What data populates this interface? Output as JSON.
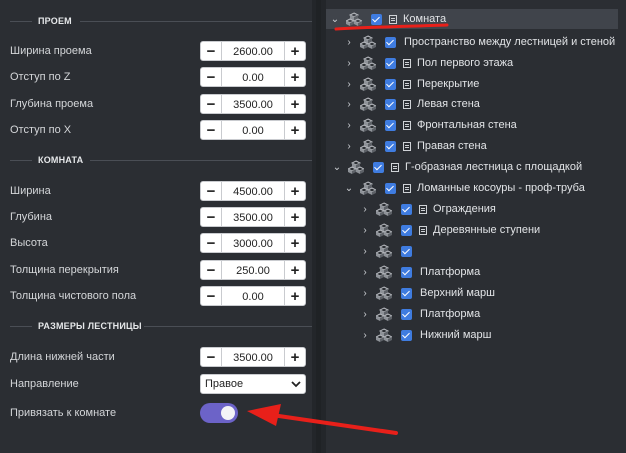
{
  "sections": {
    "opening": "ПРОЕМ",
    "room": "КОМНАТА",
    "stairs": "РАЗМЕРЫ ЛЕСТНИЦЫ"
  },
  "opening_fields": [
    {
      "label": "Ширина проема",
      "value": "2600.00"
    },
    {
      "label": "Отступ по Z",
      "value": "0.00"
    },
    {
      "label": "Глубина проема",
      "value": "3500.00"
    },
    {
      "label": "Отступ по X",
      "value": "0.00"
    }
  ],
  "room_fields": [
    {
      "label": "Ширина",
      "value": "4500.00"
    },
    {
      "label": "Глубина",
      "value": "3500.00"
    },
    {
      "label": "Высота",
      "value": "3000.00"
    },
    {
      "label": "Толщина перекрытия",
      "value": "250.00"
    },
    {
      "label": "Толщина чистового пола",
      "value": "0.00"
    }
  ],
  "stairs_fields": {
    "lower_length": {
      "label": "Длина нижней части",
      "value": "3500.00"
    },
    "direction": {
      "label": "Направление",
      "value": "Правое"
    },
    "bind_to_room": {
      "label": "Привязать к комнате",
      "enabled": true
    }
  },
  "stepper": {
    "minus": "−",
    "plus": "+"
  },
  "tree": [
    {
      "name": "Комната",
      "checked": true,
      "has_doc": true,
      "expanded": true
    },
    {
      "name": "Пространство между лестницей и стеной",
      "checked": true,
      "has_doc": false,
      "expanded": false
    },
    {
      "name": "Пол первого этажа",
      "checked": true,
      "has_doc": true,
      "expanded": false
    },
    {
      "name": "Перекрытие",
      "checked": true,
      "has_doc": true,
      "expanded": false
    },
    {
      "name": "Левая стена",
      "checked": true,
      "has_doc": true,
      "expanded": false
    },
    {
      "name": "Фронтальная стена",
      "checked": true,
      "has_doc": true,
      "expanded": false
    },
    {
      "name": "Правая стена",
      "checked": true,
      "has_doc": true,
      "expanded": false
    },
    {
      "name": "Г-образная лестница с площадкой",
      "checked": true,
      "has_doc": true,
      "expanded": true
    },
    {
      "name": "Ломанные косоуры - проф-труба",
      "checked": true,
      "has_doc": true,
      "expanded": true
    },
    {
      "name": "Ограждения",
      "checked": true,
      "has_doc": true,
      "expanded": false
    },
    {
      "name": "Деревянные ступени",
      "checked": true,
      "has_doc": true,
      "expanded": false
    },
    {
      "name": "",
      "checked": true,
      "has_doc": false,
      "expanded": false
    },
    {
      "name": "Платформа",
      "checked": true,
      "has_doc": false,
      "expanded": false
    },
    {
      "name": "Верхний марш",
      "checked": true,
      "has_doc": false,
      "expanded": false
    },
    {
      "name": "Платформа",
      "checked": true,
      "has_doc": false,
      "expanded": false
    },
    {
      "name": "Нижний марш",
      "checked": true,
      "has_doc": false,
      "expanded": false
    }
  ],
  "colors": {
    "toggle_on": "#6c63c8",
    "checkbox": "#3f7ce0",
    "annotation": "#e8201a"
  }
}
